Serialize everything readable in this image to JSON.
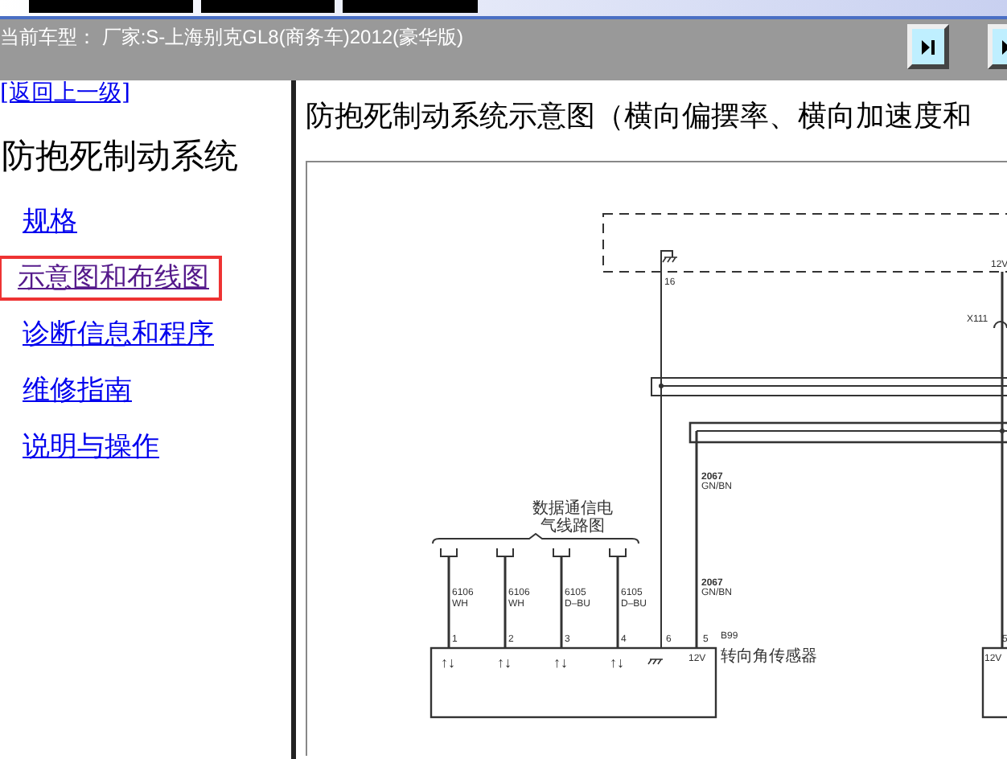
{
  "top_tabs": [
    {
      "selected": false
    },
    {
      "selected": false
    },
    {
      "selected": false
    }
  ],
  "header": {
    "text": "当前车型： 厂家:S-上海别克GL8(商务车)2012(豪华版)"
  },
  "sidebar": {
    "back_link": "[返回上一级]",
    "title": "防抱死制动系统",
    "items": [
      {
        "label": "规格",
        "selected": false
      },
      {
        "label": "示意图和布线图",
        "selected": true
      },
      {
        "label": "诊断信息和程序",
        "selected": false
      },
      {
        "label": "维修指南",
        "selected": false
      },
      {
        "label": "说明与操作",
        "selected": false
      }
    ]
  },
  "content": {
    "title": "防抱死制动系统示意图（横向偏摆率、横向加速度和",
    "diagram": {
      "ground_pin": "16",
      "supply_label": "12V",
      "connector": "X111",
      "harness_label": [
        "数据通信电",
        "气线路图"
      ],
      "wires": [
        {
          "circuit": "6106",
          "wire_code": "WH",
          "pin": "1",
          "arrows": "↑↓"
        },
        {
          "circuit": "6106",
          "wire_code": "WH",
          "pin": "2",
          "arrows": "↑↓"
        },
        {
          "circuit": "6105",
          "wire_code": "D–BU",
          "pin": "3",
          "arrows": "↑↓"
        },
        {
          "circuit": "6105",
          "wire_code": "D–BU",
          "pin": "4",
          "arrows": "↑↓"
        }
      ],
      "ground_wire_pin": "6",
      "power_wire_pin": "5",
      "power_wire_labels": [
        {
          "circuit": "2067",
          "wire_code": "GN/BN"
        },
        {
          "circuit": "2067",
          "wire_code": "GN/BN"
        }
      ],
      "component_id": "B99",
      "component_name": "转向角传感器",
      "component_supply": "12V",
      "right_component_pin": "5",
      "right_component_supply": "12V"
    }
  }
}
